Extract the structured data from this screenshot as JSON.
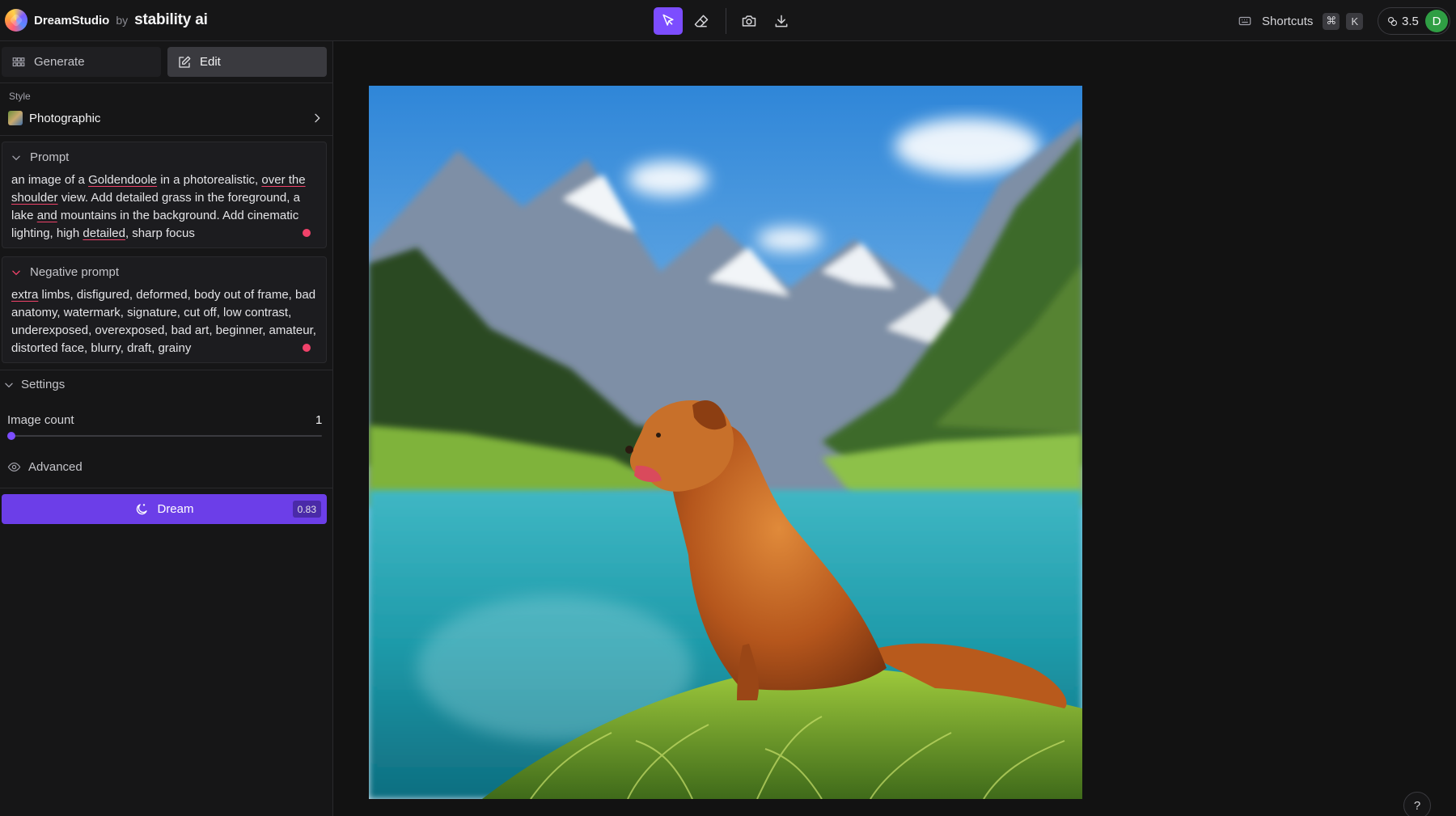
{
  "app": {
    "name": "DreamStudio",
    "by": "by",
    "company": "stability ai"
  },
  "toolbar": {
    "tools": [
      {
        "name": "select",
        "icon": "cursor-icon",
        "active": true
      },
      {
        "name": "erase",
        "icon": "eraser-icon",
        "active": false
      },
      {
        "name": "snapshot",
        "icon": "camera-icon",
        "active": false
      },
      {
        "name": "download",
        "icon": "download-icon",
        "active": false
      }
    ],
    "accent": "#7c4dff"
  },
  "header": {
    "shortcuts_label": "Shortcuts",
    "shortcut_keys": [
      "⌘",
      "K"
    ],
    "credits": "3.5",
    "avatar_initial": "D",
    "avatar_color": "#2f9e44"
  },
  "sidebar": {
    "tabs": [
      {
        "label": "Generate",
        "icon": "grid-icon",
        "active": false
      },
      {
        "label": "Edit",
        "icon": "edit-icon",
        "active": true
      }
    ],
    "style": {
      "label": "Style",
      "value": "Photographic"
    },
    "prompt": {
      "label": "Prompt",
      "text_parts": [
        "an image of a ",
        "Goldendoole",
        " in a photorealistic, ",
        "over the shoulder",
        " view. Add detailed grass in the foreground, a lake ",
        "and",
        " mountains in the background. Add cinematic lighting, high ",
        "detailed",
        ", sharp focus"
      ]
    },
    "negative_prompt": {
      "label": "Negative prompt",
      "text_parts": [
        "extra",
        " limbs, disfigured, deformed, body out of frame, bad anatomy, watermark, signature, cut off, low contrast, underexposed, overexposed, bad art, beginner, amateur, distorted face, blurry, draft, grainy"
      ]
    },
    "settings": {
      "label": "Settings",
      "image_count_label": "Image count",
      "image_count": "1",
      "image_count_fraction": 0,
      "advanced_label": "Advanced"
    },
    "dream": {
      "label": "Dream",
      "cost": "0.83",
      "color": "#6c3ee8"
    }
  },
  "canvas": {
    "help_label": "?"
  }
}
